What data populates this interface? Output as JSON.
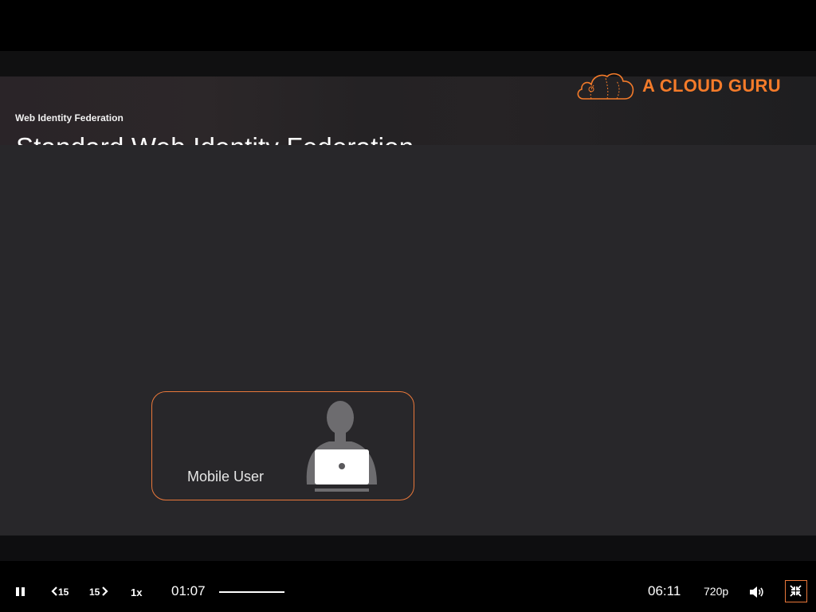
{
  "slide": {
    "subtitle": "Web Identity Federation",
    "title": "Standard Web Identity Federation",
    "brand_text": "A CLOUD GURU",
    "brand_color": "#f47b2a",
    "user_box_label": "Mobile User",
    "user_box_border_color": "#e9783a"
  },
  "controls": {
    "pause_icon": "pause-icon",
    "rewind_label": "15",
    "forward_label": "15",
    "speed_label": "1x",
    "current_time": "01:07",
    "total_time": "06:11",
    "quality_label": "720p",
    "volume_icon": "volume-icon",
    "fullscreen_icon": "exit-fullscreen-icon"
  }
}
